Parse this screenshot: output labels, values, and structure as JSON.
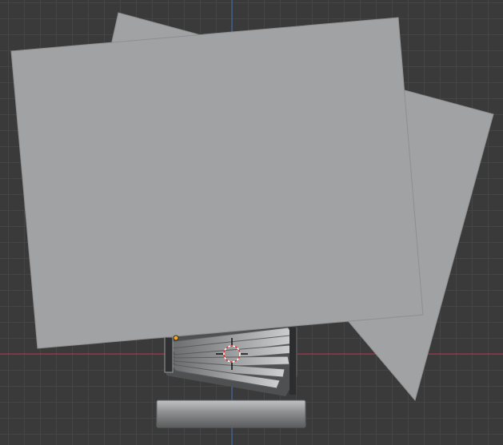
{
  "viewport": {
    "type": "3d-viewport",
    "grid": true,
    "colors": {
      "background": "#3a3a3a",
      "grid_line": "#454545",
      "x_axis": "#b5334a",
      "z_axis": "#3e6fb3",
      "plane_fill": "#a1a2a3",
      "plane_edge": "#8e8f90",
      "origin_dot": "#f5a623"
    },
    "objects": [
      {
        "name": "back-plane",
        "kind": "plane",
        "icon": "plane"
      },
      {
        "name": "front-plane",
        "kind": "plane",
        "icon": "plane"
      },
      {
        "name": "page-flip-stack",
        "kind": "mesh",
        "icon": "mesh"
      },
      {
        "name": "cylinder",
        "kind": "cylinder",
        "icon": "cylinder"
      }
    ],
    "cursor": {
      "icon": "3d-cursor-icon"
    }
  }
}
